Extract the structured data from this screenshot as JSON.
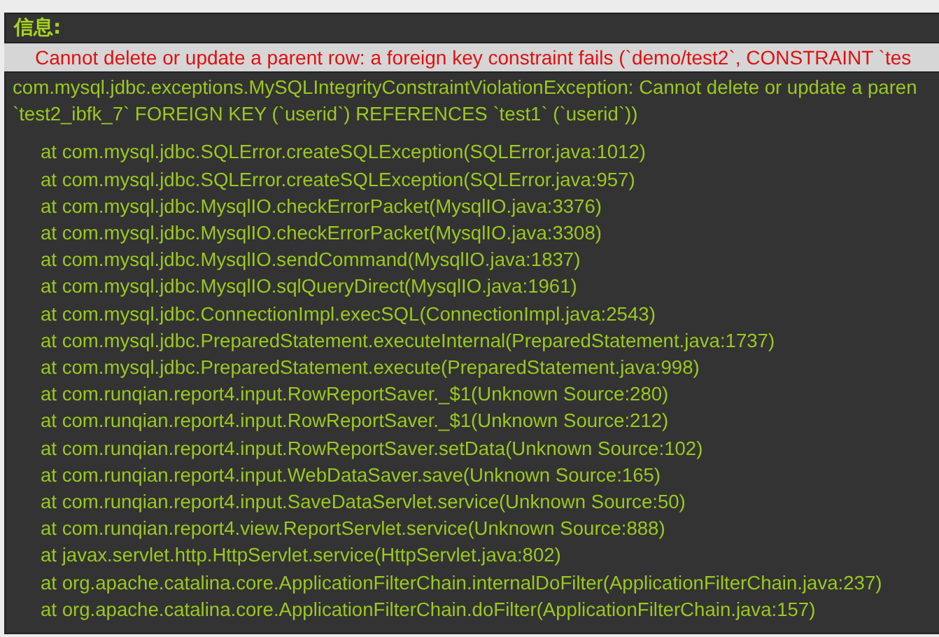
{
  "header": {
    "title": "信息:"
  },
  "message": "Cannot delete or update a parent row: a foreign key constraint fails (`demo/test2`, CONSTRAINT `tes",
  "exception": [
    "com.mysql.jdbc.exceptions.MySQLIntegrityConstraintViolationException: Cannot delete or update a paren",
    "`test2_ibfk_7` FOREIGN KEY (`userid`) REFERENCES `test1` (`userid`))"
  ],
  "stack": [
    "at com.mysql.jdbc.SQLError.createSQLException(SQLError.java:1012)",
    "at com.mysql.jdbc.SQLError.createSQLException(SQLError.java:957)",
    "at com.mysql.jdbc.MysqlIO.checkErrorPacket(MysqlIO.java:3376)",
    "at com.mysql.jdbc.MysqlIO.checkErrorPacket(MysqlIO.java:3308)",
    "at com.mysql.jdbc.MysqlIO.sendCommand(MysqlIO.java:1837)",
    "at com.mysql.jdbc.MysqlIO.sqlQueryDirect(MysqlIO.java:1961)",
    "at com.mysql.jdbc.ConnectionImpl.execSQL(ConnectionImpl.java:2543)",
    "at com.mysql.jdbc.PreparedStatement.executeInternal(PreparedStatement.java:1737)",
    "at com.mysql.jdbc.PreparedStatement.execute(PreparedStatement.java:998)",
    "at com.runqian.report4.input.RowReportSaver._$1(Unknown Source:280)",
    "at com.runqian.report4.input.RowReportSaver._$1(Unknown Source:212)",
    "at com.runqian.report4.input.RowReportSaver.setData(Unknown Source:102)",
    "at com.runqian.report4.input.WebDataSaver.save(Unknown Source:165)",
    "at com.runqian.report4.input.SaveDataServlet.service(Unknown Source:50)",
    "at com.runqian.report4.view.ReportServlet.service(Unknown Source:888)",
    "at javax.servlet.http.HttpServlet.service(HttpServlet.java:802)",
    "at org.apache.catalina.core.ApplicationFilterChain.internalDoFilter(ApplicationFilterChain.java:237)",
    "at org.apache.catalina.core.ApplicationFilterChain.doFilter(ApplicationFilterChain.java:157)"
  ]
}
